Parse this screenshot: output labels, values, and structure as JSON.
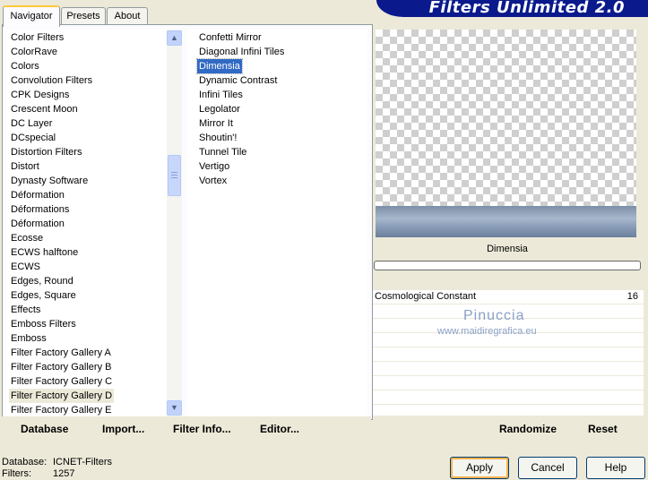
{
  "tabs": [
    "Navigator",
    "Presets",
    "About"
  ],
  "banner_title": "Filters Unlimited 2.0",
  "categories": [
    "Color Filters",
    "ColorRave",
    "Colors",
    "Convolution Filters",
    "CPK Designs",
    "Crescent Moon",
    "DC Layer",
    "DCspecial",
    "Distortion Filters",
    "Distort",
    "Dynasty Software",
    "Déformation",
    "Déformations",
    "Déformation",
    "Ecosse",
    "ECWS halftone",
    "ECWS",
    "Edges, Round",
    "Edges, Square",
    "Effects",
    "Emboss Filters",
    "Emboss",
    "Filter Factory Gallery A",
    "Filter Factory Gallery B",
    "Filter Factory Gallery C",
    "Filter Factory Gallery D",
    "Filter Factory Gallery E"
  ],
  "filters": [
    "Confetti Mirror",
    "Diagonal Infini Tiles",
    "Dimensia",
    "Dynamic Contrast",
    "Infini Tiles",
    "Legolator",
    "Mirror It",
    "Shoutin'!",
    "Tunnel Tile",
    "Vertigo",
    "Vortex"
  ],
  "selected_filter": "Dimensia",
  "preview_filter_name": "Dimensia",
  "param": {
    "name": "Cosmological Constant",
    "value": "16"
  },
  "watermark": {
    "line1": "Pinuccia",
    "line2": "www.maidiregrafica.eu"
  },
  "buttons": {
    "database": "Database",
    "import": "Import...",
    "filter_info": "Filter Info...",
    "editor": "Editor...",
    "randomize": "Randomize",
    "reset": "Reset",
    "apply": "Apply",
    "cancel": "Cancel",
    "help": "Help"
  },
  "status": {
    "db_label": "Database:",
    "db_value": "ICNET-Filters",
    "filters_label": "Filters:",
    "filters_value": "1257"
  }
}
